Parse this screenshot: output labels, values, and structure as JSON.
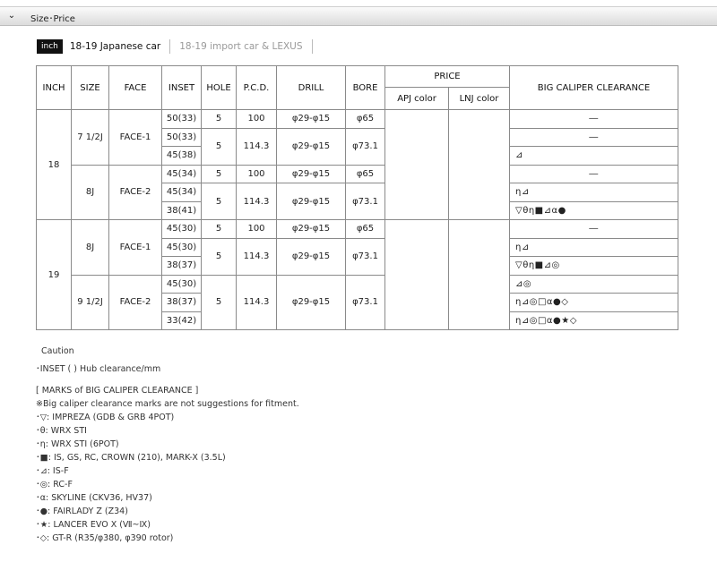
{
  "header": {
    "toggle_glyph": "⌄",
    "title": "Size･Price"
  },
  "tabs": {
    "badge": "inch",
    "items": [
      {
        "label": "18-19 Japanese car",
        "active": true
      },
      {
        "label": "18-19 import car & LEXUS",
        "active": false
      }
    ]
  },
  "table": {
    "headers": {
      "inch": "INCH",
      "size": "SIZE",
      "face": "FACE",
      "inset": "INSET",
      "hole": "HOLE",
      "pcd": "P.C.D.",
      "drill": "DRILL",
      "bore": "BORE",
      "price": "PRICE",
      "apj": "APJ color",
      "lnj": "LNJ color",
      "clearance": "BIG CALIPER CLEARANCE"
    },
    "groups": [
      {
        "inch": "18",
        "sizes": [
          {
            "size": "7 1/2J",
            "face": "FACE-1",
            "rows": [
              {
                "inset": "50(33)",
                "hole": "5",
                "pcd": "100",
                "drill": "φ29-φ15",
                "bore": "φ65",
                "clearance": "―"
              },
              {
                "inset": "50(33)",
                "hole": "5",
                "pcd": "114.3",
                "drill": "φ29-φ15",
                "bore": "φ73.1",
                "clearance": "―"
              },
              {
                "inset": "45(38)",
                "clearance": "⊿"
              }
            ]
          },
          {
            "size": "8J",
            "face": "FACE-2",
            "rows": [
              {
                "inset": "45(34)",
                "hole": "5",
                "pcd": "100",
                "drill": "φ29-φ15",
                "bore": "φ65",
                "clearance": "―"
              },
              {
                "inset": "45(34)",
                "hole": "5",
                "pcd": "114.3",
                "drill": "φ29-φ15",
                "bore": "φ73.1",
                "clearance": "η⊿"
              },
              {
                "inset": "38(41)",
                "clearance": "▽θη■⊿α●"
              }
            ]
          }
        ]
      },
      {
        "inch": "19",
        "sizes": [
          {
            "size": "8J",
            "face": "FACE-1",
            "rows": [
              {
                "inset": "45(30)",
                "hole": "5",
                "pcd": "100",
                "drill": "φ29-φ15",
                "bore": "φ65",
                "clearance": "―"
              },
              {
                "inset": "45(30)",
                "hole": "5",
                "pcd": "114.3",
                "drill": "φ29-φ15",
                "bore": "φ73.1",
                "clearance": "η⊿"
              },
              {
                "inset": "38(37)",
                "clearance": "▽θη■⊿◎"
              }
            ]
          },
          {
            "size": "9 1/2J",
            "face": "FACE-2",
            "rows": [
              {
                "inset": "45(30)",
                "hole": "5",
                "pcd": "114.3",
                "drill": "φ29-φ15",
                "bore": "φ73.1",
                "clearance": "⊿◎"
              },
              {
                "inset": "38(37)",
                "clearance": "η⊿◎□α●◇"
              },
              {
                "inset": "33(42)",
                "clearance": "η⊿◎□α●★◇"
              }
            ]
          }
        ]
      }
    ]
  },
  "notes": {
    "caution": "Caution",
    "inset_note": "･INSET ( ) Hub clearance/mm",
    "marks_title": "[ MARKS of BIG CALIPER CLEARANCE ]",
    "disclaimer": "※Big caliper clearance marks are not suggestions for fitment.",
    "marks": [
      "･▽: IMPREZA (GDB & GRB 4POT)",
      "･θ: WRX STI",
      "･η: WRX STI (6POT)",
      "･■: IS, GS, RC, CROWN (210), MARK-X (3.5L)",
      "･⊿: IS-F",
      "･◎: RC-F",
      "･α: SKYLINE (CKV36, HV37)",
      "･●: FAIRLADY Z (Z34)",
      "･★: LANCER EVO X (Ⅶ~Ⅸ)",
      "･◇: GT-R (R35/φ380, φ390 rotor)"
    ]
  }
}
